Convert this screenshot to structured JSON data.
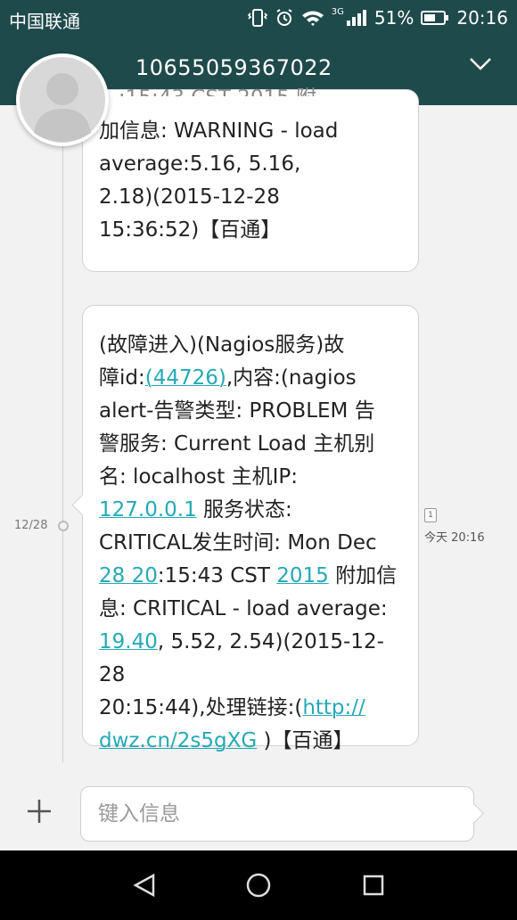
{
  "status": {
    "carrier": "中国联通",
    "network": "3G",
    "battery": "51%",
    "time": "20:16"
  },
  "conversation": {
    "phone": "10655059367022"
  },
  "messages": [
    {
      "top_fragment": "...:15:43 CST 2015 附",
      "lines": [
        "加信息: WARNING - load",
        "average:5.16, 5.16,",
        "2.18)(2015-12-28",
        "15:36:52)【百通】"
      ]
    },
    {
      "line1": "(故障进入)(Nagios服务)故",
      "line2_prefix": "障id:",
      "line2_link": "(44726)",
      "line2_suffix": ",内容:(nagios",
      "line3": "alert-告警类型: PROBLEM 告",
      "line4": "警服务: Current Load 主机别",
      "line5": "名: localhost 主机IP:",
      "line6_link": "127.0.0.1",
      "line6_suffix": " 服务状态:",
      "line7": "CRITICAL发生时间: Mon Dec",
      "line8_link": "28 20",
      "line8_mid": ":15:43 CST ",
      "line8_link2": "2015",
      "line8_suffix": " 附加信",
      "line9": "息: CRITICAL - load average:",
      "line10_link": "19.40",
      "line10_suffix": ", 5.52, 2.54)(2015-12-28",
      "line11_prefix": "20:15:44),处理链接:(",
      "line11_link": "http://",
      "line12_link": "dwz.cn/2s5gXG",
      "line12_suffix": " )【百通】",
      "date": "12/28",
      "sms_index": "1",
      "time": "今天 20:16"
    }
  ],
  "composer": {
    "placeholder": "键入信息"
  }
}
